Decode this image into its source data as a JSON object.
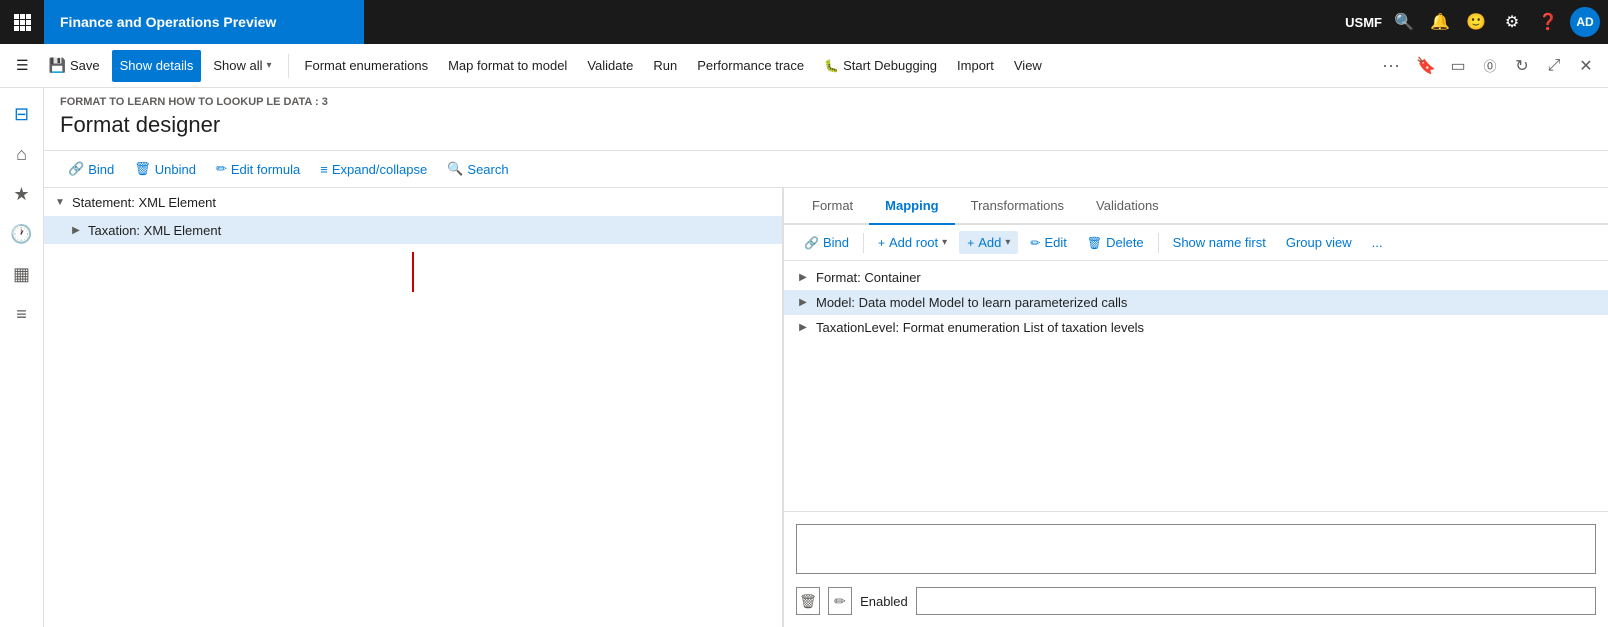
{
  "app": {
    "title": "Finance and Operations Preview",
    "user": "USMF",
    "avatar": "AD"
  },
  "commandBar": {
    "save": "Save",
    "showDetails": "Show details",
    "showAll": "Show all",
    "formatEnumerations": "Format enumerations",
    "mapFormatToModel": "Map format to model",
    "validate": "Validate",
    "run": "Run",
    "performanceTrace": "Performance trace",
    "startDebugging": "Start Debugging",
    "import": "Import",
    "view": "View"
  },
  "page": {
    "breadcrumb": "FORMAT TO LEARN HOW TO LOOKUP LE DATA : 3",
    "title": "Format designer"
  },
  "toolbar": {
    "bind": "Bind",
    "unbind": "Unbind",
    "editFormula": "Edit formula",
    "expandCollapse": "Expand/collapse",
    "search": "Search"
  },
  "treeItems": [
    {
      "label": "Statement: XML Element",
      "level": 0,
      "expanded": true,
      "selected": false
    },
    {
      "label": "Taxation: XML Element",
      "level": 1,
      "expanded": false,
      "selected": true
    }
  ],
  "tabs": [
    {
      "label": "Format",
      "active": false
    },
    {
      "label": "Mapping",
      "active": true
    },
    {
      "label": "Transformations",
      "active": false
    },
    {
      "label": "Validations",
      "active": false
    }
  ],
  "rightToolbar": {
    "bind": "Bind",
    "addRoot": "Add root",
    "add": "Add",
    "edit": "Edit",
    "delete": "Delete",
    "showNameFirst": "Show name first",
    "groupView": "Group view",
    "more": "..."
  },
  "dataSources": [
    {
      "label": "Format: Container",
      "level": 0,
      "expanded": false,
      "highlighted": false
    },
    {
      "label": "Model: Data model Model to learn parameterized calls",
      "level": 0,
      "expanded": false,
      "highlighted": true
    },
    {
      "label": "TaxationLevel: Format enumeration List of taxation levels",
      "level": 0,
      "expanded": false,
      "highlighted": false
    }
  ],
  "bottomSection": {
    "textboxValue": "",
    "enabledLabel": "Enabled",
    "enabledValue": ""
  },
  "sidebar": {
    "items": [
      {
        "icon": "home",
        "name": "home-icon"
      },
      {
        "icon": "star",
        "name": "favorites-icon"
      },
      {
        "icon": "clock",
        "name": "recent-icon"
      },
      {
        "icon": "calendar",
        "name": "workspaces-icon"
      },
      {
        "icon": "list",
        "name": "modules-icon"
      }
    ]
  }
}
